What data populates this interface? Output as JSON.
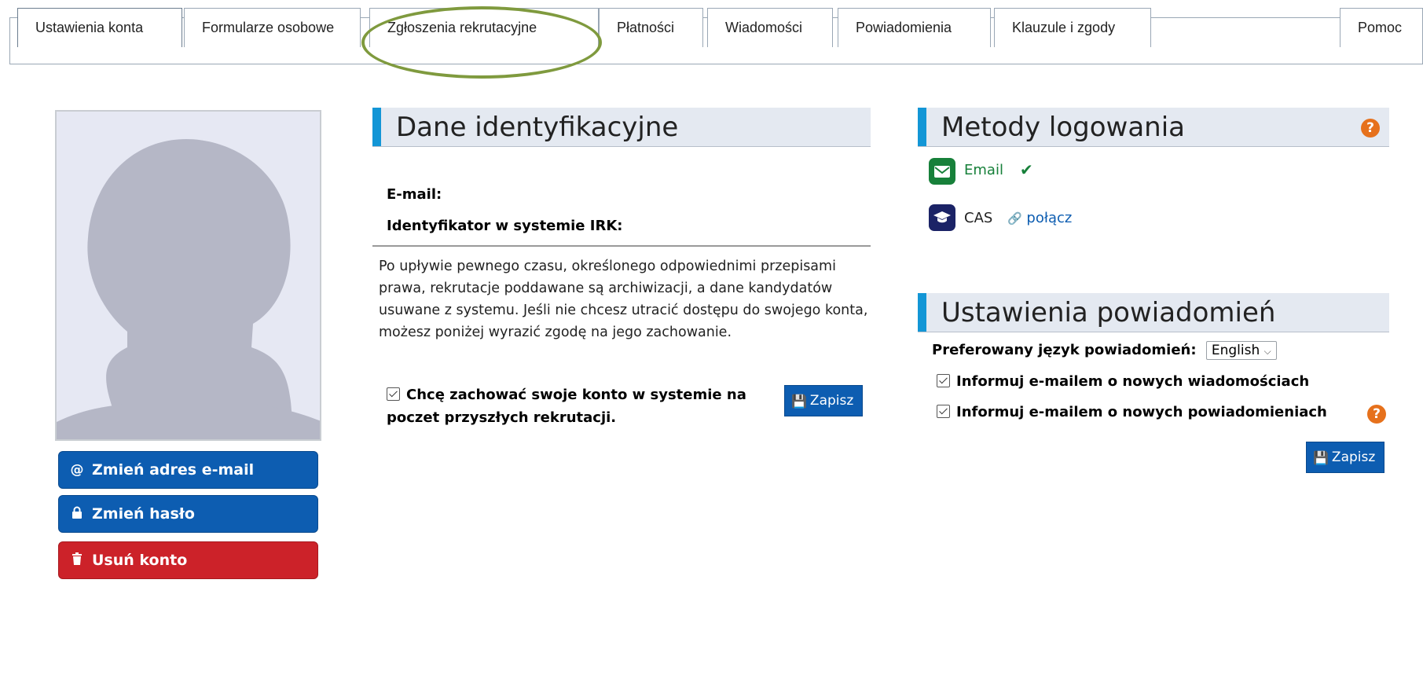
{
  "tabs": [
    {
      "label": "Ustawienia konta"
    },
    {
      "label": "Formularze osobowe"
    },
    {
      "label": "Zgłoszenia rekrutacyjne"
    },
    {
      "label": "Płatności"
    },
    {
      "label": "Wiadomości"
    },
    {
      "label": "Powiadomienia"
    },
    {
      "label": "Klauzule i zgody"
    },
    {
      "label": "Pomoc"
    }
  ],
  "account_actions": {
    "change_email": "Zmień adres e-mail",
    "change_password": "Zmień hasło",
    "delete_account": "Usuń konto"
  },
  "identification": {
    "heading": "Dane identyfikacyjne",
    "email_label": "E-mail:",
    "irk_id_label": "Identyfikator w systemie IRK:",
    "archive_notice": "Po upływie pewnego czasu, określonego odpowiednimi przepisami prawa, rekrutacje poddawane są archiwizacji, a dane kandydatów usuwane z systemu. Jeśli nie chcesz utracić dostępu do swojego konta, możesz poniżej wyrazić zgodę na jego zachowanie.",
    "keep_account_label": "Chcę zachować swoje konto w systemie na poczet przyszłych rekrutacji.",
    "keep_account_checked": true,
    "save_label": "Zapisz"
  },
  "login_methods": {
    "heading": "Metody logowania",
    "email_label": "Email",
    "email_connected": true,
    "cas_label": "CAS",
    "connect_label": "połącz"
  },
  "notification_settings": {
    "heading": "Ustawienia powiadomień",
    "language_label": "Preferowany język powiadomień:",
    "language_value": "English",
    "notify_messages_label": "Informuj e-mailem o nowych wiadomościach",
    "notify_messages_checked": true,
    "notify_notifications_label": "Informuj e-mailem o nowych powiadomieniach",
    "notify_notifications_checked": true,
    "save_label": "Zapisz"
  },
  "colors": {
    "primary_button": "#0d5db1",
    "danger_button": "#cc2229",
    "section_accent": "#1396d6",
    "help_icon": "#e6711c",
    "email_icon_bg": "#17803a",
    "cas_icon_bg": "#1b2366",
    "highlight_ellipse": "#7f9a3e"
  }
}
